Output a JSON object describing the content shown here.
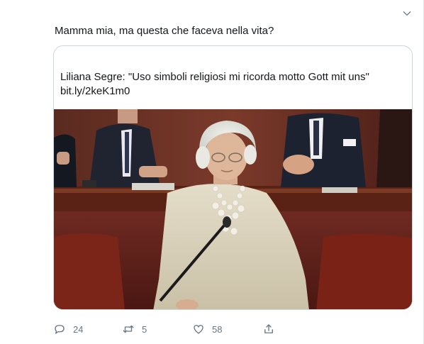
{
  "tweet": {
    "text": "Mamma mia, ma questa che faceva nella vita?",
    "menu_icon": "chevron-down-icon"
  },
  "card": {
    "title": "Liliana Segre: \"Uso simboli religiosi mi ricorda motto Gott mit uns\"",
    "link": "bit.ly/2keK1m0",
    "image": "photo of elderly woman speaking at a microphone in a parliament chamber"
  },
  "actions": {
    "reply_count": "24",
    "retweet_count": "5",
    "like_count": "58",
    "reply_icon": "reply-icon",
    "retweet_icon": "retweet-icon",
    "like_icon": "heart-icon",
    "share_icon": "share-icon"
  },
  "colors": {
    "text": "#14171a",
    "muted": "#657786",
    "card_border": "#ccd6dd"
  }
}
